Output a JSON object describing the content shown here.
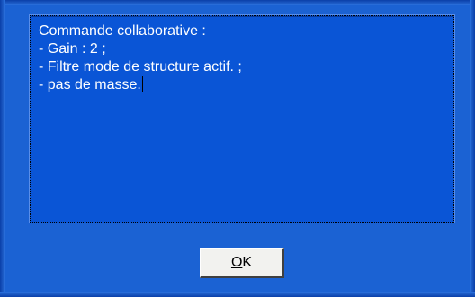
{
  "dialog": {
    "message_lines": [
      "Commande collaborative :",
      "- Gain : 2 ;",
      "- Filtre mode de structure actif. ;",
      "- pas de masse."
    ],
    "ok_button": {
      "mnemonic": "O",
      "rest": "K"
    }
  },
  "colors": {
    "background": "#1b62d3",
    "text_area": "#0a55d6",
    "text": "#ffffff",
    "button_face": "#f2f2ef"
  }
}
